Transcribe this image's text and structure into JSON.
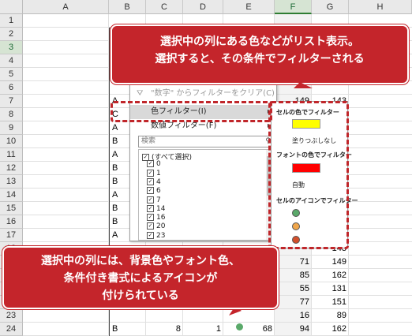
{
  "columns": [
    "A",
    "B",
    "C",
    "D",
    "E",
    "F",
    "G",
    "H"
  ],
  "rows": [
    "1",
    "2",
    "3",
    "4",
    "5",
    "6",
    "7",
    "8",
    "9",
    "10",
    "11",
    "12",
    "13",
    "14",
    "15",
    "16",
    "17",
    "18",
    "19",
    "20",
    "21",
    "22",
    "23",
    "24"
  ],
  "col_b_values": [
    {
      "row": "7",
      "text": "A"
    },
    {
      "row": "8",
      "text": "C"
    },
    {
      "row": "9",
      "text": "A"
    },
    {
      "row": "10",
      "text": "B"
    },
    {
      "row": "11",
      "text": "A"
    },
    {
      "row": "12",
      "text": "B"
    },
    {
      "row": "13",
      "text": "B"
    },
    {
      "row": "14",
      "text": "A"
    },
    {
      "row": "15",
      "text": "B"
    },
    {
      "row": "16",
      "text": "B"
    },
    {
      "row": "17",
      "text": "A"
    },
    {
      "row": "24",
      "text": "B"
    }
  ],
  "col_f_values": [
    {
      "row": "7",
      "text": "149"
    },
    {
      "row": "19",
      "text": "71"
    },
    {
      "row": "20",
      "text": "85"
    },
    {
      "row": "21",
      "text": "55"
    },
    {
      "row": "22",
      "text": "77"
    },
    {
      "row": "23",
      "text": "16"
    },
    {
      "row": "24",
      "text": "94"
    }
  ],
  "col_g_values": [
    {
      "row": "7",
      "text": "143"
    },
    {
      "row": "18",
      "text": "143"
    },
    {
      "row": "19",
      "text": "149"
    },
    {
      "row": "20",
      "text": "162"
    },
    {
      "row": "21",
      "text": "131"
    },
    {
      "row": "22",
      "text": "151"
    },
    {
      "row": "23",
      "text": "89"
    },
    {
      "row": "24",
      "text": "162"
    }
  ],
  "row24": {
    "c": "8",
    "d": "1",
    "e": "68"
  },
  "menu": {
    "clear_filter": "\"数字\" からフィルターをクリア(C)",
    "color_filter": "色フィルター(I)",
    "number_filter": "数値フィルター(F)",
    "search_placeholder": "検索",
    "items": [
      "(すべて選択)",
      "0",
      "1",
      "4",
      "6",
      "7",
      "14",
      "16",
      "20",
      "23"
    ]
  },
  "submenu": {
    "cell_color_heading": "セルの色でフィルター",
    "no_fill": "塗りつぶしなし",
    "font_color_heading": "フォントの色でフィルター",
    "auto": "自動",
    "icon_heading": "セルのアイコンでフィルター",
    "cell_color": "#ffff00",
    "font_color": "#ff0000",
    "icon_colors": [
      "#5aa96a",
      "#f0a64a",
      "#d2502c"
    ]
  },
  "callouts": {
    "top_line1": "選択中の列にある色などがリスト表示。",
    "top_line2": "選択すると、その条件でフィルターされる",
    "bottom_line1": "選択中の列には、背景色やフォント色、",
    "bottom_line2": "条件付き書式によるアイコンが",
    "bottom_line3": "付けられている"
  }
}
